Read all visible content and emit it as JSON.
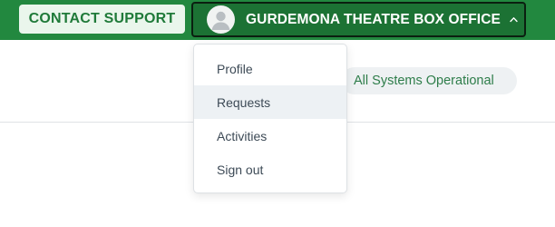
{
  "header": {
    "contact_label": "CONTACT SUPPORT",
    "account_name": "GURDEMONA THEATRE BOX OFFICE",
    "avatar_icon": "user-avatar-icon",
    "chevron_icon": "chevron-up-icon"
  },
  "status": {
    "text": "All Systems Operational"
  },
  "menu": {
    "items": [
      {
        "label": "Profile"
      },
      {
        "label": "Requests",
        "active": true
      },
      {
        "label": "Activities"
      },
      {
        "label": "Sign out"
      }
    ]
  },
  "colors": {
    "brand_green": "#22883f",
    "account_button": "#1c7234",
    "status_text": "#2e7d4a"
  }
}
